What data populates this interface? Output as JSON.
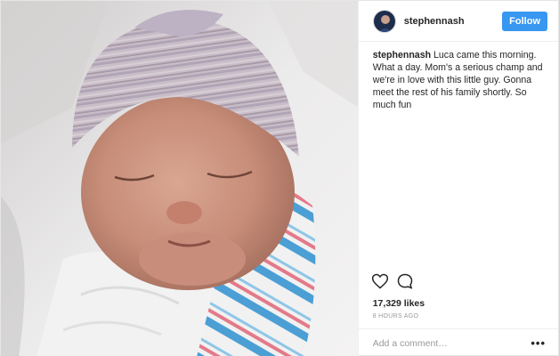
{
  "post": {
    "username": "stephennash",
    "follow_label": "Follow",
    "caption_user": "stephennash",
    "caption_text": " Luca came this morning. What a day. Mom's a serious champ and we're in love with this little guy. Gonna meet the rest of his family shortly. So much fun",
    "likes": "17,329 likes",
    "time": "8 HOURS AGO",
    "comment_placeholder": "Add a comment…",
    "more_label": "•••"
  },
  "icons": {
    "like": "heart-outline-icon",
    "comment": "speech-bubble-icon",
    "more": "three-dots-icon"
  },
  "colors": {
    "follow_button": "#3897f0",
    "text": "#262626",
    "muted": "#999999",
    "divider": "#efefef"
  }
}
